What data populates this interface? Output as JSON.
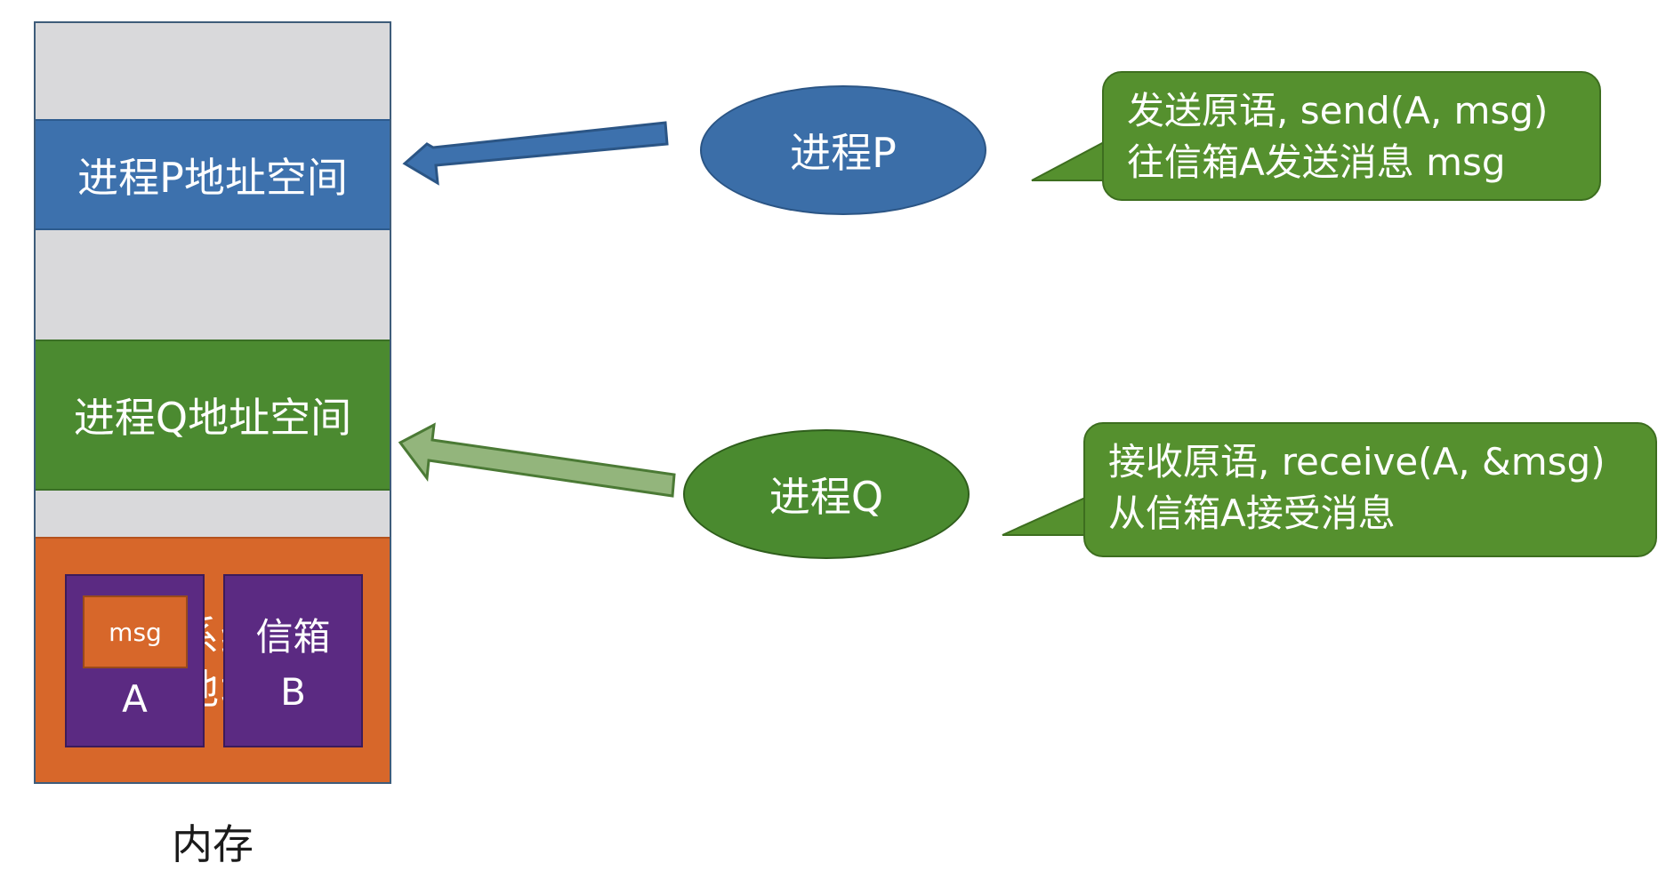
{
  "memory": {
    "process_p_space": "进程P地址空间",
    "process_q_space": "进程Q地址空间",
    "os_space_partial": "系统\n地址",
    "mailbox_a": {
      "label": "A",
      "message": "msg"
    },
    "mailbox_b": {
      "label": "信箱\nB"
    },
    "caption": "内存"
  },
  "processes": {
    "p": "进程P",
    "q": "进程Q"
  },
  "callouts": {
    "send_line1": "发送原语, send(A, msg)",
    "send_line2": "往信箱A发送消息 msg",
    "receive_line1": "接收原语, receive(A, &msg)",
    "receive_line2": "从信箱A接受消息"
  },
  "colors": {
    "process_p": "#3d71ad",
    "process_q": "#4b8a30",
    "os": "#d7672a",
    "mailbox": "#5b2a82",
    "memory_free": "#d9d9db"
  }
}
